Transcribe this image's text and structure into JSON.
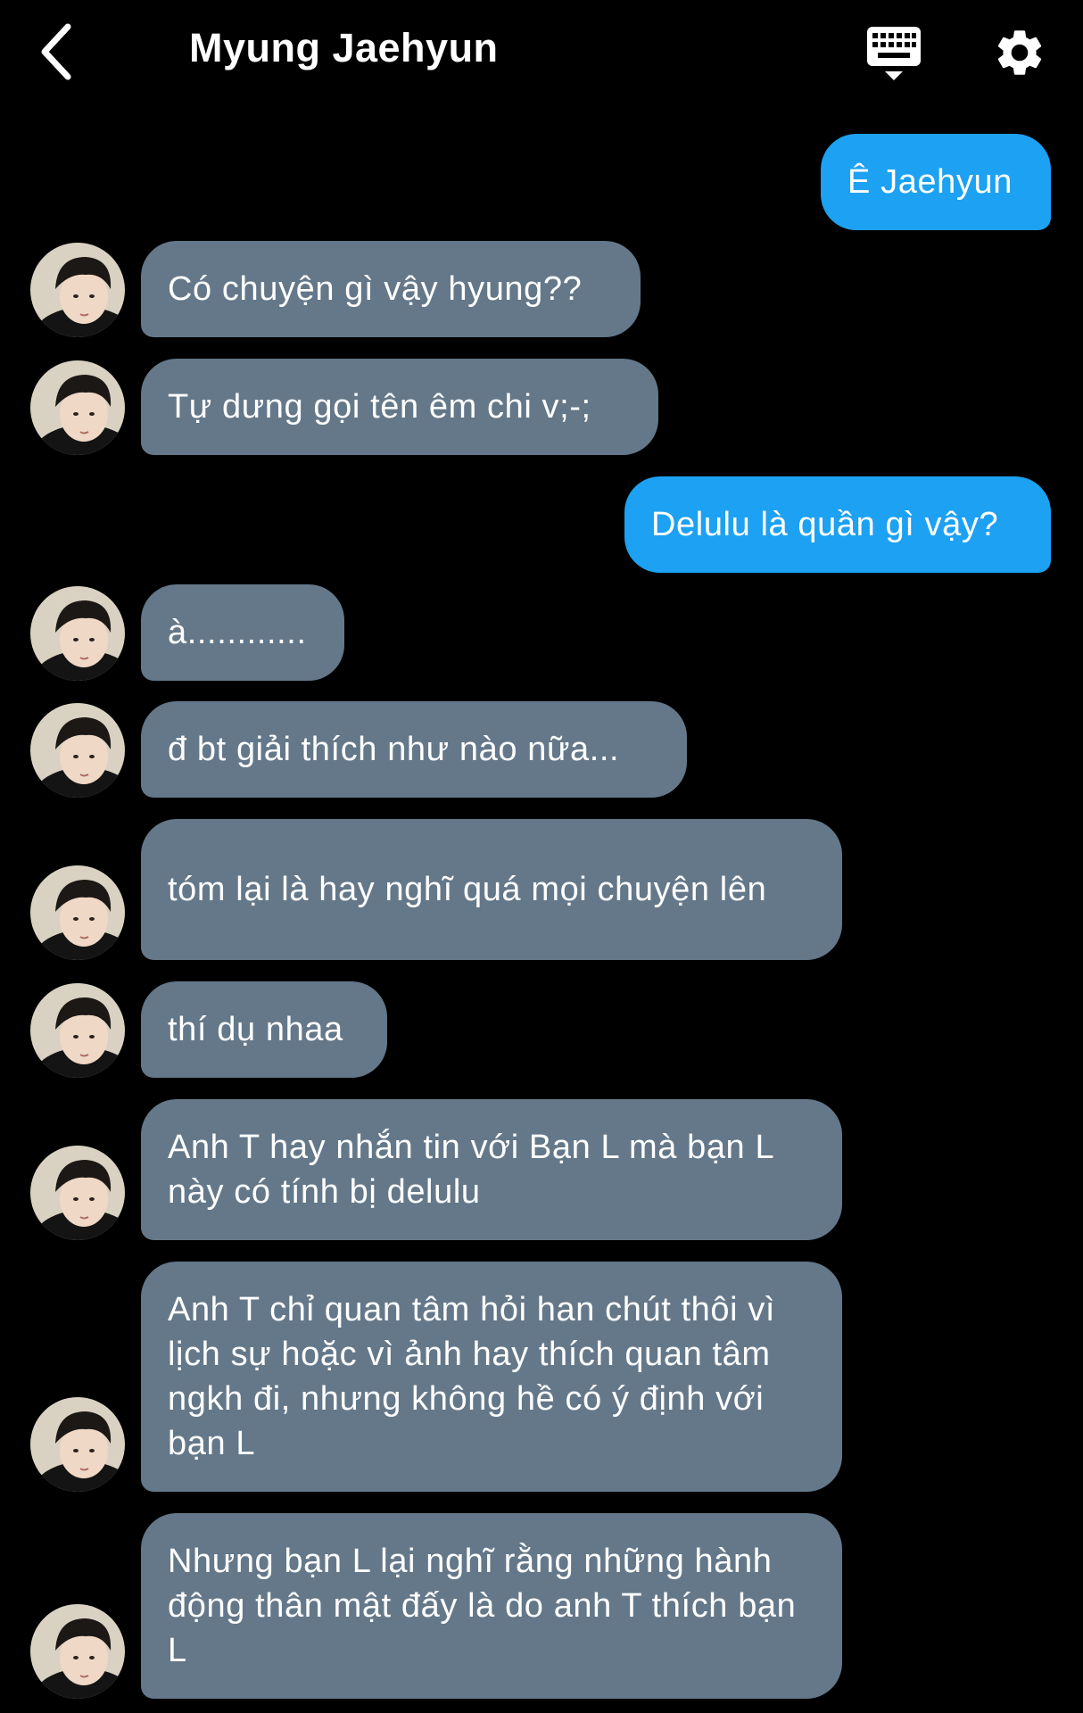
{
  "header": {
    "title": "Myung Jaehyun",
    "back_icon": "chevron-left-icon",
    "keyboard_icon": "keyboard-icon",
    "settings_icon": "gear-icon"
  },
  "colors": {
    "background": "#000000",
    "incoming_bubble": "#64788a",
    "outgoing_bubble": "#1da1f2",
    "text": "#ffffff"
  },
  "messages": [
    {
      "sender": "me",
      "text": "Ê Jaehyun"
    },
    {
      "sender": "them",
      "text": "Có chuyện gì vậy hyung??"
    },
    {
      "sender": "them",
      "text": "Tự dưng gọi tên êm chi v;-;"
    },
    {
      "sender": "me",
      "text": "Delulu là quần gì vậy?"
    },
    {
      "sender": "them",
      "text": "à............"
    },
    {
      "sender": "them",
      "text": "đ bt giải thích như nào nữa..."
    },
    {
      "sender": "them",
      "text": "tóm lại là hay nghĩ quá mọi chuyện lên"
    },
    {
      "sender": "them",
      "text": "thí dụ nhaa"
    },
    {
      "sender": "them",
      "text": "Anh T hay nhắn tin với Bạn L mà bạn L này có tính bị delulu"
    },
    {
      "sender": "them",
      "text": "Anh T chỉ quan tâm hỏi han chút thôi vì lịch sự hoặc vì ảnh hay thích quan tâm ngkh đi, nhưng không hề có ý định với bạn L"
    },
    {
      "sender": "them",
      "text": "Nhưng bạn L lại nghĩ rằng những hành động thân mật đấy là do anh T thích bạn L"
    }
  ]
}
